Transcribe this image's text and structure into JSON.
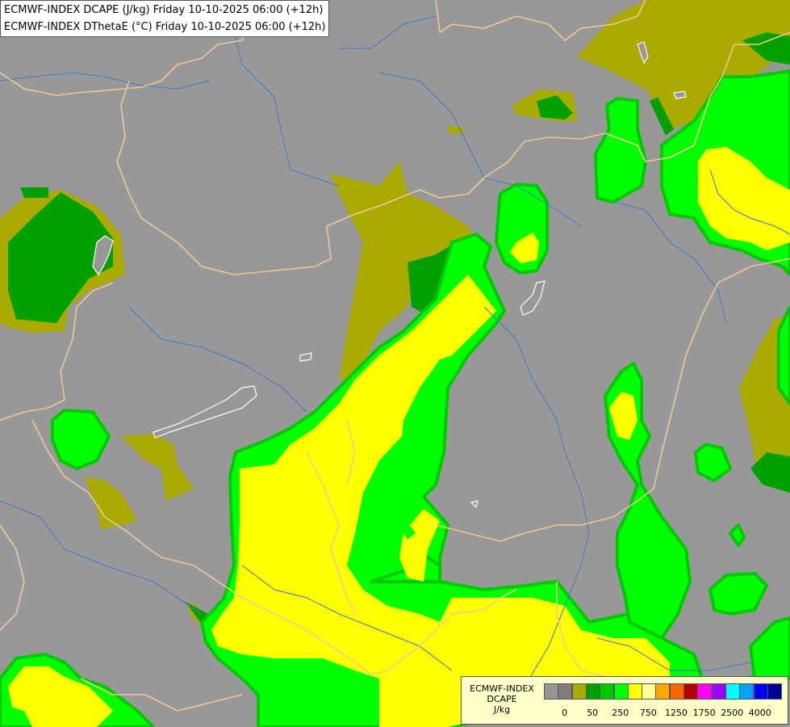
{
  "title": {
    "line1": "ECMWF-INDEX DCAPE (J/kg) Friday 10-10-2025 06:00 (+12h)",
    "line2": "ECMWF-INDEX DThetaE (°C) Friday 10-10-2025 06:00 (+12h)"
  },
  "legend": {
    "line1": "ECMWF-INDEX",
    "line2": "DCAPE",
    "line3": "J/kg",
    "colors": [
      "#969696",
      "#7d7d7d",
      "#aaaa00",
      "#00a000",
      "#00c800",
      "#00ff00",
      "#ffff00",
      "#ffff96",
      "#ffa500",
      "#ff6400",
      "#b40000",
      "#ff00ff",
      "#a000ff",
      "#00ffff",
      "#00a0ff",
      "#0000ff",
      "#000096"
    ],
    "ticks": [
      "0",
      "50",
      "250",
      "750",
      "1250",
      "1750",
      "2500",
      "4000"
    ]
  },
  "palette": {
    "background": "#989898",
    "olive": "#aaaa00",
    "dark_green": "#00a000",
    "medium_green": "#00c800",
    "bright_green": "#00ff00",
    "yellow": "#ffff00",
    "border_line": "#f0c896",
    "river": "#3c78c8",
    "lake": "#ffffff"
  }
}
